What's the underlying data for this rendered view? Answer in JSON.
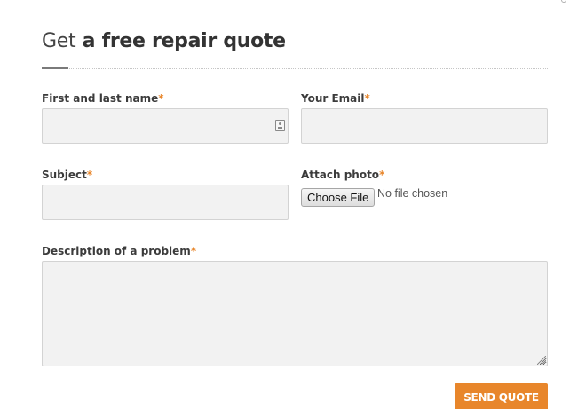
{
  "form": {
    "title_prefix": "Get",
    "title_emphasis": "a free repair quote",
    "required_marker": "*",
    "fields": {
      "name": {
        "label": "First and last name",
        "value": "",
        "icon": "contact-card-icon"
      },
      "email": {
        "label": "Your Email",
        "value": ""
      },
      "subject": {
        "label": "Subject",
        "value": ""
      },
      "photo": {
        "label": "Attach photo",
        "button_label": "Choose File",
        "status": "No file chosen"
      },
      "description": {
        "label": "Description of a problem",
        "value": ""
      }
    },
    "submit_label": "SEND QUOTE"
  },
  "colors": {
    "accent": "#e8862b",
    "field_background": "#f2f2f2",
    "field_border": "#d3d3d3",
    "label_text": "#3b3b3b"
  }
}
